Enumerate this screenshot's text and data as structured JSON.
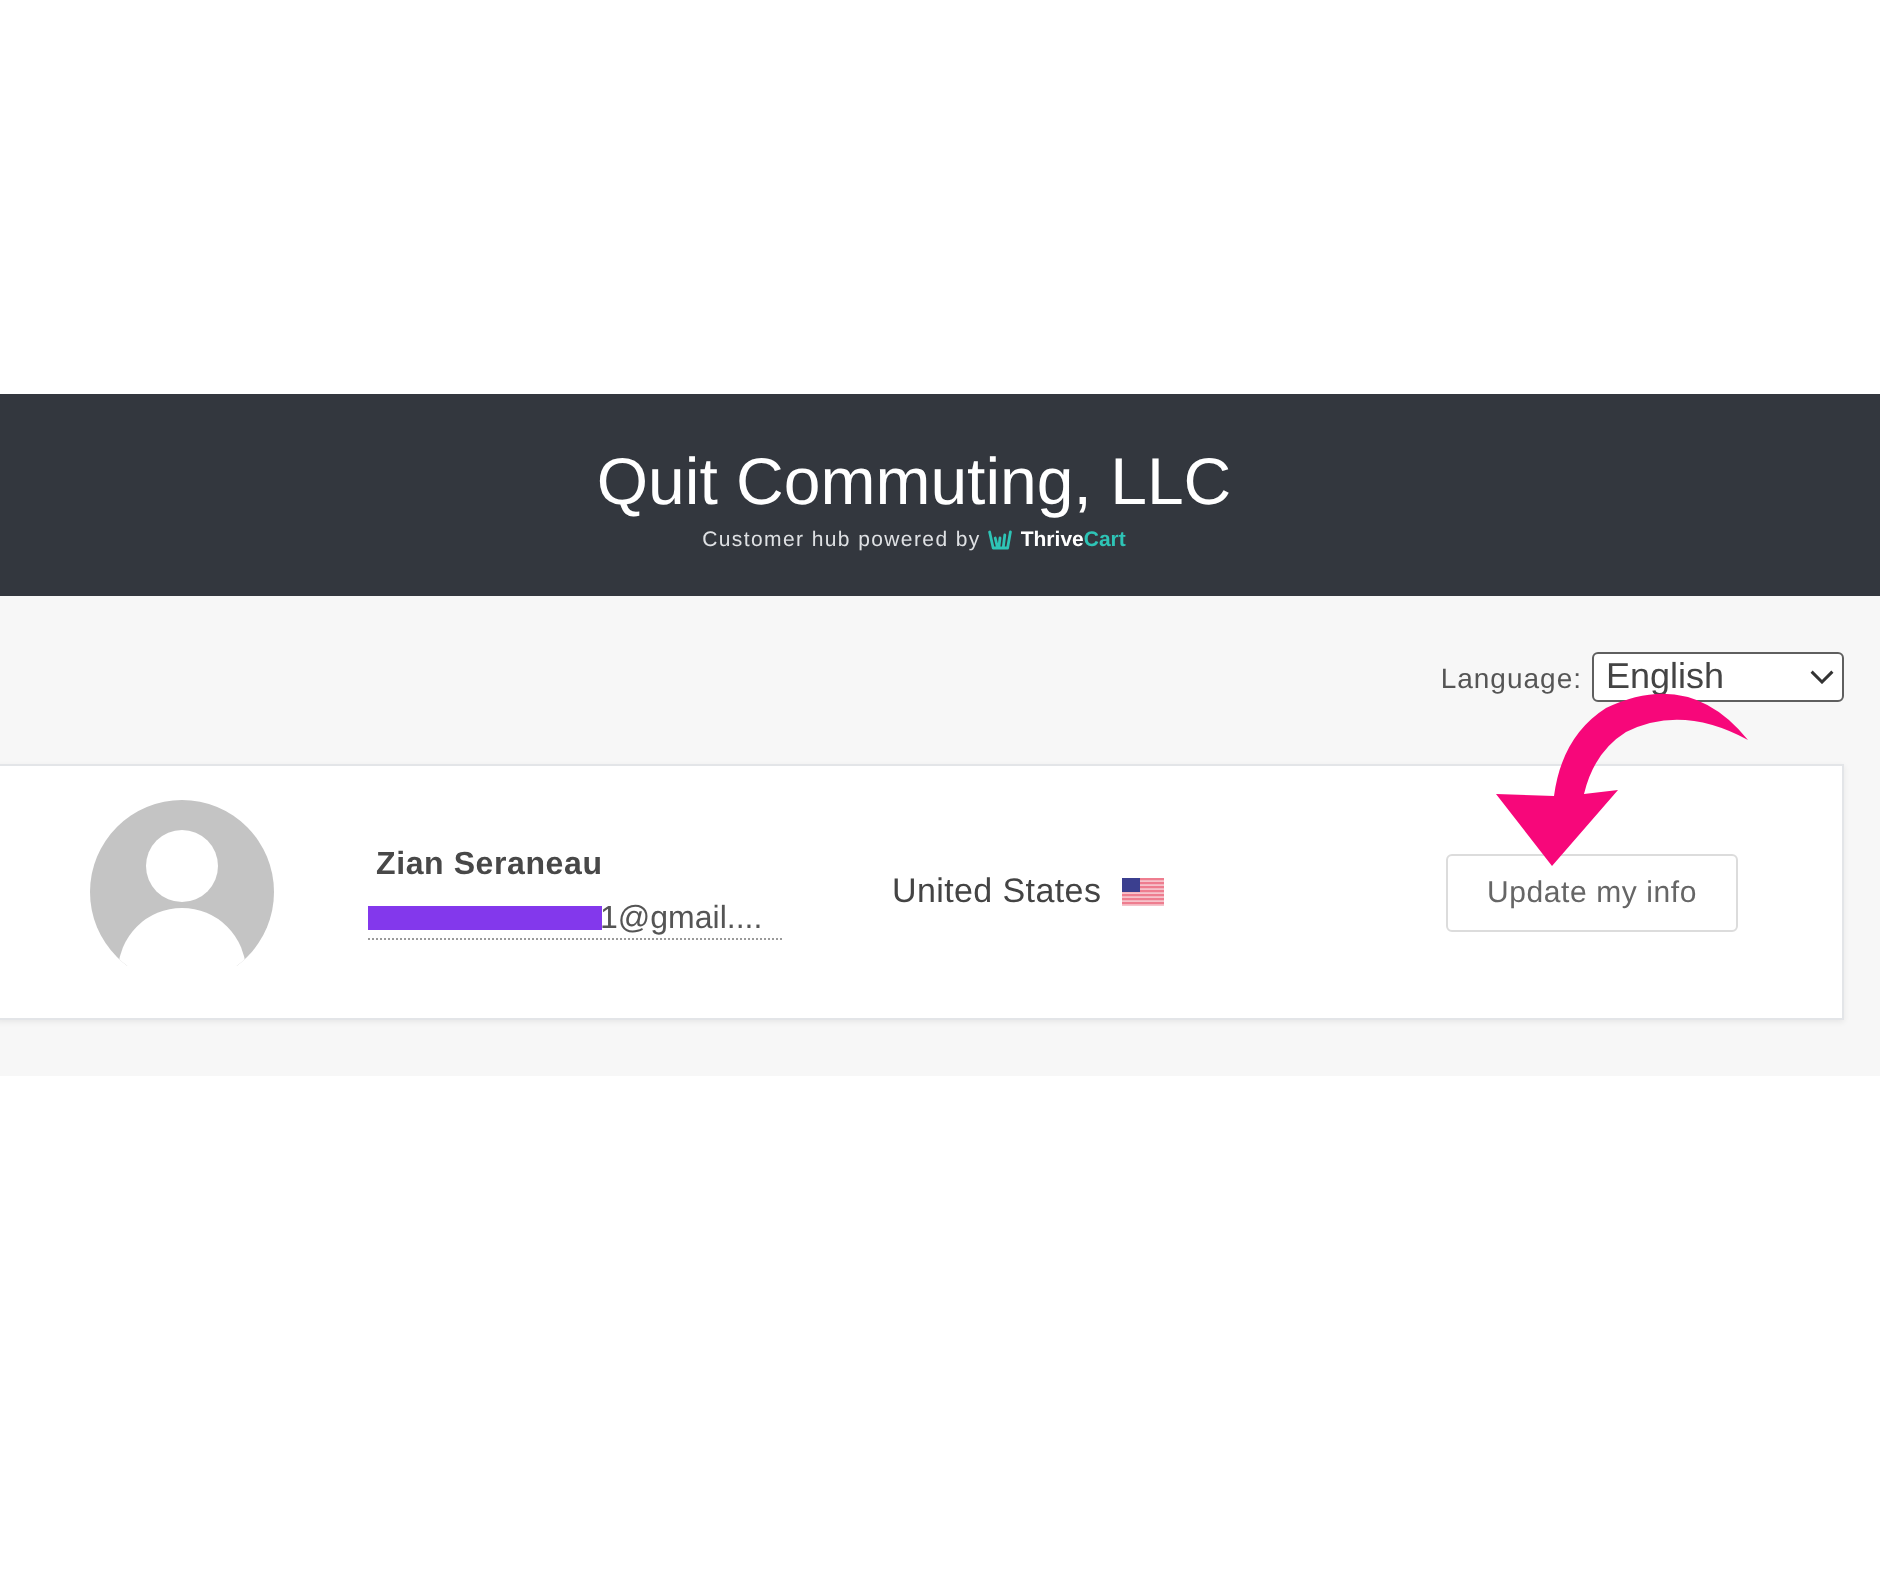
{
  "header": {
    "title": "Quit Commuting, LLC",
    "subtitle": "Customer hub powered by",
    "brand": [
      "Thrive",
      "Cart"
    ]
  },
  "language": {
    "label": "Language:",
    "value": "English"
  },
  "profile": {
    "name": "Zian Seraneau",
    "email": "1@gmail....",
    "country": "United States",
    "button": "Update my info"
  }
}
